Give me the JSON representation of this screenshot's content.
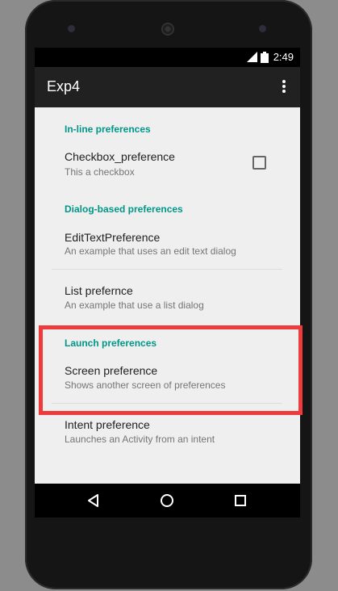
{
  "status_bar": {
    "time": "2:49"
  },
  "app_bar": {
    "title": "Exp4",
    "overflow_icon": "more-vert-icon"
  },
  "preferences": {
    "inline_category": "In-line preferences",
    "checkbox": {
      "title": "Checkbox_preference",
      "summary": "This a checkbox",
      "checked": false
    },
    "dialog_category": "Dialog-based preferences",
    "edittext": {
      "title": "EditTextPreference",
      "summary": "An example that uses an edit text dialog"
    },
    "list": {
      "title": "List prefernce",
      "summary": "An example that use a list dialog"
    },
    "launch_category": "Launch preferences",
    "screen": {
      "title": "Screen preference",
      "summary": "Shows another screen of preferences"
    },
    "intent": {
      "title": "Intent preference",
      "summary": "Launches an Activity from an intent"
    }
  },
  "nav_bar": {
    "icons": [
      "back-icon",
      "home-icon",
      "recents-icon"
    ]
  },
  "colors": {
    "accent": "#009688",
    "highlight": "#ee3b3b",
    "appbar": "#212121"
  }
}
